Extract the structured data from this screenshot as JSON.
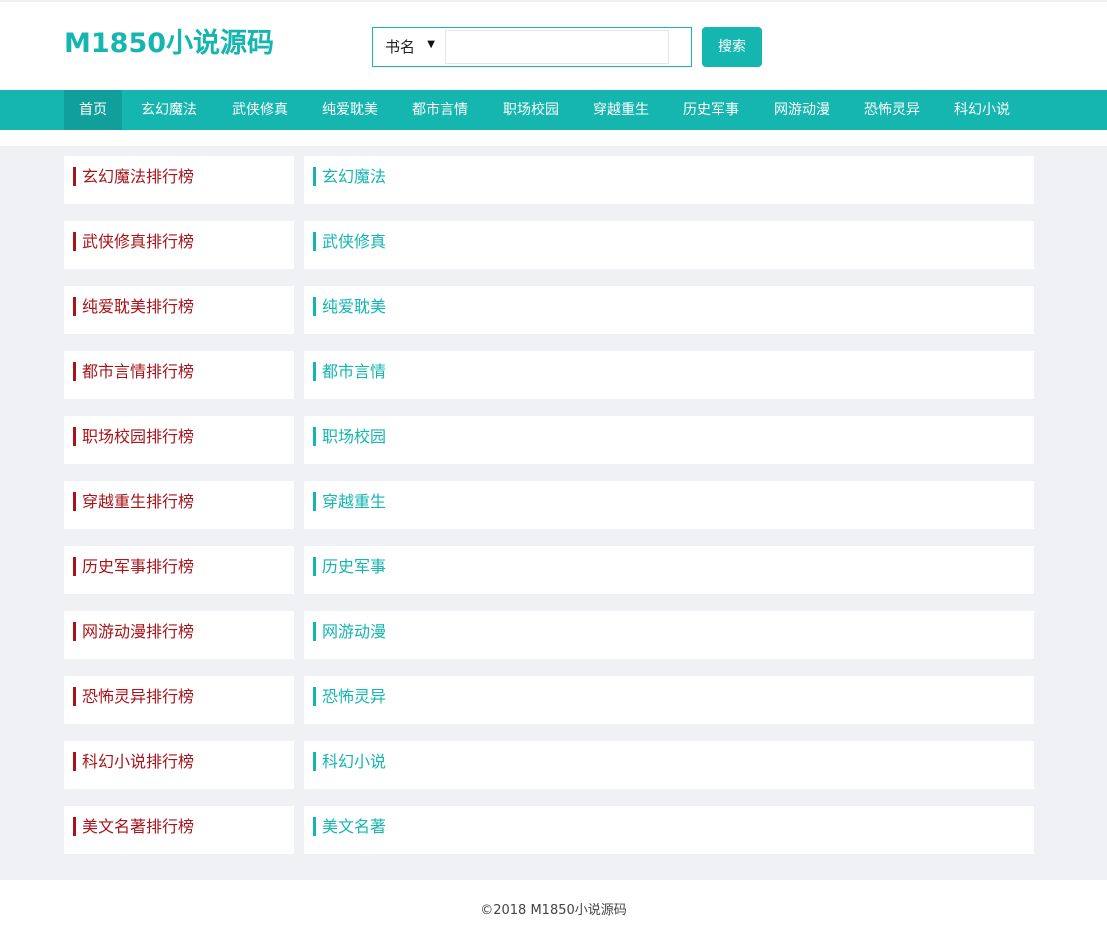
{
  "header": {
    "logo": "M1850小说源码",
    "search": {
      "select_value": "书名",
      "input_value": "",
      "input_placeholder": "",
      "button_label": "搜索"
    }
  },
  "nav": {
    "items": [
      {
        "label": "首页",
        "active": true
      },
      {
        "label": "玄幻魔法",
        "active": false
      },
      {
        "label": "武侠修真",
        "active": false
      },
      {
        "label": "纯爱耽美",
        "active": false
      },
      {
        "label": "都市言情",
        "active": false
      },
      {
        "label": "职场校园",
        "active": false
      },
      {
        "label": "穿越重生",
        "active": false
      },
      {
        "label": "历史军事",
        "active": false
      },
      {
        "label": "网游动漫",
        "active": false
      },
      {
        "label": "恐怖灵异",
        "active": false
      },
      {
        "label": "科幻小说",
        "active": false
      }
    ]
  },
  "rankings": [
    {
      "ranking_title": "玄幻魔法排行榜",
      "category": "玄幻魔法"
    },
    {
      "ranking_title": "武侠修真排行榜",
      "category": "武侠修真"
    },
    {
      "ranking_title": "纯爱耽美排行榜",
      "category": "纯爱耽美"
    },
    {
      "ranking_title": "都市言情排行榜",
      "category": "都市言情"
    },
    {
      "ranking_title": "职场校园排行榜",
      "category": "职场校园"
    },
    {
      "ranking_title": "穿越重生排行榜",
      "category": "穿越重生"
    },
    {
      "ranking_title": "历史军事排行榜",
      "category": "历史军事"
    },
    {
      "ranking_title": "网游动漫排行榜",
      "category": "网游动漫"
    },
    {
      "ranking_title": "恐怖灵异排行榜",
      "category": "恐怖灵异"
    },
    {
      "ranking_title": "科幻小说排行榜",
      "category": "科幻小说"
    },
    {
      "ranking_title": "美文名著排行榜",
      "category": "美文名著"
    }
  ],
  "footer": {
    "copyright": "©2018 M1850小说源码"
  },
  "colors": {
    "accent": "#15b5b0",
    "accent_dark": "#109f9a",
    "ranking_red": "#a8141a",
    "content_bg": "#f0f1f5"
  }
}
